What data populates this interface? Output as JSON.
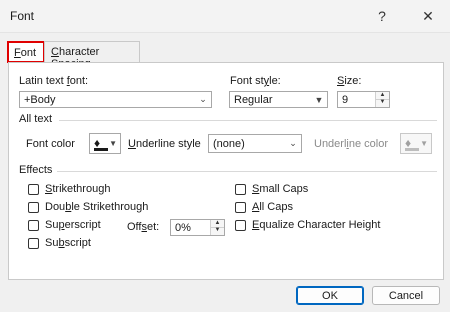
{
  "window": {
    "title": "Font",
    "help_glyph": "?",
    "close_glyph": "✕"
  },
  "tabs": [
    {
      "label": "Font",
      "underline": "F",
      "rest": "ont",
      "active": true
    },
    {
      "label": "Character Spacing",
      "underline": "C",
      "rest": "haracter Spacing",
      "active": false
    }
  ],
  "latin_font": {
    "label_pre": "Latin text ",
    "label_ul": "f",
    "label_post": "ont:",
    "value": "+Body"
  },
  "font_style": {
    "label_pre": "Font st",
    "label_ul": "y",
    "label_post": "le:",
    "value": "Regular"
  },
  "size": {
    "label_ul": "S",
    "label_post": "ize:",
    "value": "9"
  },
  "all_text": {
    "heading": "All text",
    "font_color_label": "Font color",
    "underline_style": {
      "label_ul": "U",
      "label_post": "nderline style",
      "value": "(none)"
    },
    "underline_color": {
      "label_pre": "Underl",
      "label_ul": "i",
      "label_post": "ne color",
      "disabled": true
    }
  },
  "effects": {
    "heading": "Effects",
    "left": [
      {
        "pre": "",
        "ul": "S",
        "post": "trikethrough",
        "checked": false
      },
      {
        "pre": "Dou",
        "ul": "b",
        "post": "le Strikethrough",
        "checked": false
      },
      {
        "pre": "Su",
        "ul": "p",
        "post": "erscript",
        "checked": false
      },
      {
        "pre": "Su",
        "ul": "b",
        "post": "script",
        "checked": false
      }
    ],
    "offset": {
      "label_pre": "Off",
      "label_ul": "s",
      "label_post": "et:",
      "value": "0%"
    },
    "right": [
      {
        "pre": "",
        "ul": "S",
        "post": "mall Caps",
        "checked": false
      },
      {
        "pre": "",
        "ul": "A",
        "post": "ll Caps",
        "checked": false
      },
      {
        "pre": "",
        "ul": "E",
        "post": "qualize Character Height",
        "checked": false
      }
    ]
  },
  "buttons": {
    "ok": "OK",
    "cancel": "Cancel"
  },
  "icons": {
    "dropdown": "chevron-down-icon",
    "bucket": "paint-bucket-icon"
  },
  "colors": {
    "highlight_border": "#e00000",
    "ok_border": "#0067c0",
    "font_color_swatch": "#1a1a1a"
  }
}
